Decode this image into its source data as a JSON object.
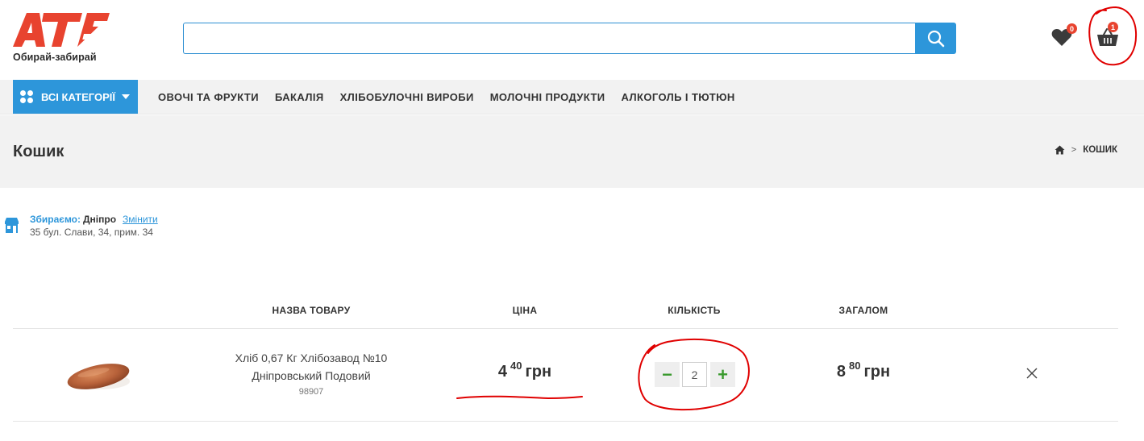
{
  "header": {
    "logo_text": "АТБ",
    "tagline": "Обирай-забирай",
    "search": {
      "value": "",
      "placeholder": ""
    },
    "search_icon": "search-icon",
    "wishlist": {
      "icon": "heart-icon",
      "count": "0"
    },
    "cart": {
      "icon": "basket-icon",
      "count": "1"
    }
  },
  "nav": {
    "all_categories": "ВСІ КАТЕГОРІЇ",
    "links": [
      "ОВОЧІ ТА ФРУКТИ",
      "БАКАЛІЯ",
      "ХЛІБОБУЛОЧНІ ВИРОБИ",
      "МОЛОЧНІ ПРОДУКТИ",
      "АЛКОГОЛЬ І ТЮТЮН"
    ]
  },
  "page": {
    "title": "Кошик",
    "breadcrumb": {
      "home_icon": "home-icon",
      "current": "КОШИК"
    }
  },
  "pickup": {
    "label": "Збираємо:",
    "city": "Дніпро",
    "change": "Змінити",
    "address": "35 бул. Слави, 34, прим. 34",
    "icon": "store-icon"
  },
  "table": {
    "headers": {
      "name": "НАЗВА ТОВАРУ",
      "price": "ЦІНА",
      "quantity": "КІЛЬКІСТЬ",
      "total": "ЗАГАЛОМ"
    },
    "rows": [
      {
        "name_line1": "Хліб 0,67 Кг Хлібозавод №10",
        "name_line2": "Дніпровський Подовий",
        "code": "98907",
        "price_int": "4",
        "price_frac": "40",
        "currency": "грн",
        "quantity": "2",
        "total_int": "8",
        "total_frac": "80",
        "minus_label": "−",
        "plus_label": "+"
      }
    ]
  },
  "colors": {
    "brand_red": "#e8432f",
    "accent_blue": "#2d96da",
    "qty_green": "#3a9a2e",
    "annotation_red": "#e00000"
  }
}
